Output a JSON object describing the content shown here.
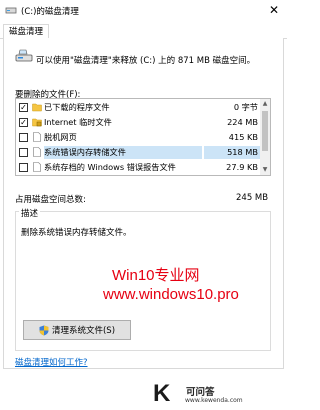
{
  "window": {
    "title": "(C:)的磁盘清理",
    "close_glyph": "✕"
  },
  "tabs": [
    {
      "label": "磁盘清理"
    }
  ],
  "info_text": "可以使用\"磁盘清理\"来释放 (C:) 上的 871 MB 磁盘空间。",
  "list_label": "要删除的文件(F):",
  "files": [
    {
      "name": "已下载的程序文件",
      "size": "0 字节",
      "checked": true,
      "icon": "folder-icon",
      "selected": false
    },
    {
      "name": "Internet 临时文件",
      "size": "224 MB",
      "checked": true,
      "icon": "lock-folder-icon",
      "selected": false
    },
    {
      "name": "脱机网页",
      "size": "415 KB",
      "checked": false,
      "icon": "page-icon",
      "selected": false
    },
    {
      "name": "系统错误内存转储文件",
      "size": "518 MB",
      "checked": false,
      "icon": "page-icon",
      "selected": true
    },
    {
      "name": "系统存档的 Windows 错误报告文件",
      "size": "27.9 KB",
      "checked": false,
      "icon": "page-icon",
      "selected": false
    }
  ],
  "total": {
    "label": "占用磁盘空间总数:",
    "value": "245 MB"
  },
  "description": {
    "legend": "描述",
    "text": "删除系统错误内存转储文件。"
  },
  "watermark": {
    "line1": "Win10专业网",
    "line2": "www.windows10.pro",
    "color": "#e60012"
  },
  "clean_button": {
    "label": "清理系统文件(S)",
    "icon": "shield-icon"
  },
  "help_link": "磁盘清理如何工作?",
  "brand": {
    "logo_letter": "K",
    "name": "可问答",
    "url": "www.kewenda.com"
  },
  "colors": {
    "selection": "#cce4f7",
    "link": "#0066cc",
    "button_bg": "#e1e1e1"
  }
}
